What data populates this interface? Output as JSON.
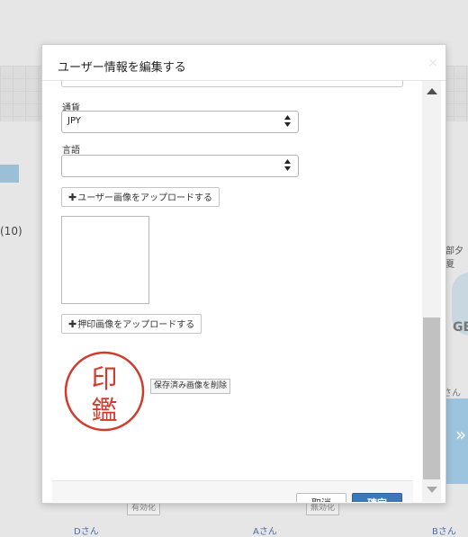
{
  "background": {
    "count_text": "(10)",
    "right_text": "部夕夏",
    "avatar_text": "GE",
    "right_san": "さん",
    "blue_card_glyph": "»",
    "pills": [
      "有効化",
      "無効化"
    ],
    "names": [
      "Dさん",
      "Aさん",
      "Bさん"
    ]
  },
  "modal": {
    "title": "ユーザー情報を編集する",
    "close_glyph": "×",
    "currency": {
      "label": "通貨",
      "value": "JPY"
    },
    "language": {
      "label": "言語",
      "value": ""
    },
    "upload_user_image": {
      "plus": "✚",
      "label": "ユーザー画像をアップロードする"
    },
    "upload_seal_image": {
      "plus": "✚",
      "label": "押印画像をアップロードする"
    },
    "seal_chars": [
      "印",
      "鑑"
    ],
    "delete_saved_image": "保存済み画像を削除",
    "cancel": "取消",
    "confirm": "確定"
  },
  "colors": {
    "seal_red": "#d03b2e",
    "confirm_blue": "#3a78b8",
    "link_blue": "#4a6ea8"
  }
}
